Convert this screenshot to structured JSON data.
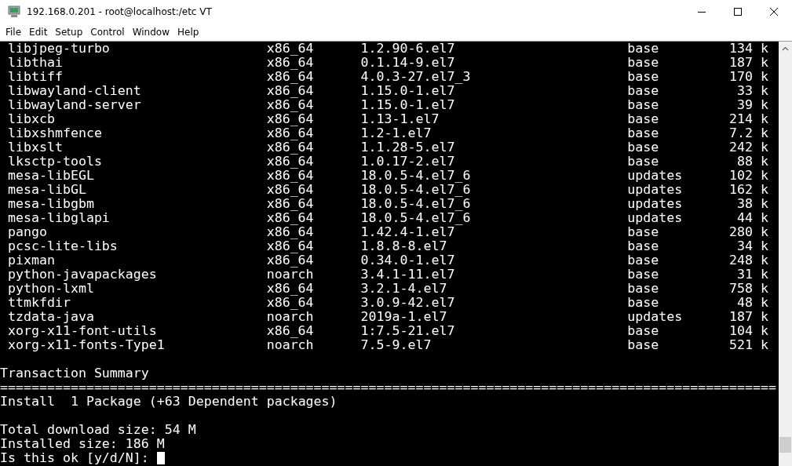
{
  "window": {
    "title": "192.168.0.201 - root@localhost:/etc VT"
  },
  "menu": [
    "File",
    "Edit",
    "Setup",
    "Control",
    "Window",
    "Help"
  ],
  "terminal": {
    "packages": [
      {
        "name": "libjpeg-turbo",
        "arch": "x86_64",
        "version": "1.2.90-6.el7",
        "repository": "base",
        "size": "134 k"
      },
      {
        "name": "libthai",
        "arch": "x86_64",
        "version": "0.1.14-9.el7",
        "repository": "base",
        "size": "187 k"
      },
      {
        "name": "libtiff",
        "arch": "x86_64",
        "version": "4.0.3-27.el7_3",
        "repository": "base",
        "size": "170 k"
      },
      {
        "name": "libwayland-client",
        "arch": "x86_64",
        "version": "1.15.0-1.el7",
        "repository": "base",
        "size": "33 k"
      },
      {
        "name": "libwayland-server",
        "arch": "x86_64",
        "version": "1.15.0-1.el7",
        "repository": "base",
        "size": "39 k"
      },
      {
        "name": "libxcb",
        "arch": "x86_64",
        "version": "1.13-1.el7",
        "repository": "base",
        "size": "214 k"
      },
      {
        "name": "libxshmfence",
        "arch": "x86_64",
        "version": "1.2-1.el7",
        "repository": "base",
        "size": "7.2 k"
      },
      {
        "name": "libxslt",
        "arch": "x86_64",
        "version": "1.1.28-5.el7",
        "repository": "base",
        "size": "242 k"
      },
      {
        "name": "lksctp-tools",
        "arch": "x86_64",
        "version": "1.0.17-2.el7",
        "repository": "base",
        "size": "88 k"
      },
      {
        "name": "mesa-libEGL",
        "arch": "x86_64",
        "version": "18.0.5-4.el7_6",
        "repository": "updates",
        "size": "102 k"
      },
      {
        "name": "mesa-libGL",
        "arch": "x86_64",
        "version": "18.0.5-4.el7_6",
        "repository": "updates",
        "size": "162 k"
      },
      {
        "name": "mesa-libgbm",
        "arch": "x86_64",
        "version": "18.0.5-4.el7_6",
        "repository": "updates",
        "size": "38 k"
      },
      {
        "name": "mesa-libglapi",
        "arch": "x86_64",
        "version": "18.0.5-4.el7_6",
        "repository": "updates",
        "size": "44 k"
      },
      {
        "name": "pango",
        "arch": "x86_64",
        "version": "1.42.4-1.el7",
        "repository": "base",
        "size": "280 k"
      },
      {
        "name": "pcsc-lite-libs",
        "arch": "x86_64",
        "version": "1.8.8-8.el7",
        "repository": "base",
        "size": "34 k"
      },
      {
        "name": "pixman",
        "arch": "x86_64",
        "version": "0.34.0-1.el7",
        "repository": "base",
        "size": "248 k"
      },
      {
        "name": "python-javapackages",
        "arch": "noarch",
        "version": "3.4.1-11.el7",
        "repository": "base",
        "size": "31 k"
      },
      {
        "name": "python-lxml",
        "arch": "x86_64",
        "version": "3.2.1-4.el7",
        "repository": "base",
        "size": "758 k"
      },
      {
        "name": "ttmkfdir",
        "arch": "x86_64",
        "version": "3.0.9-42.el7",
        "repository": "base",
        "size": "48 k"
      },
      {
        "name": "tzdata-java",
        "arch": "noarch",
        "version": "2019a-1.el7",
        "repository": "updates",
        "size": "187 k"
      },
      {
        "name": "xorg-x11-font-utils",
        "arch": "x86_64",
        "version": "1:7.5-21.el7",
        "repository": "base",
        "size": "104 k"
      },
      {
        "name": "xorg-x11-fonts-Type1",
        "arch": "noarch",
        "version": "7.5-9.el7",
        "repository": "base",
        "size": "521 k"
      }
    ],
    "summary_title": "Transaction Summary",
    "separator": "===================================================================================================",
    "install_line": "Install  1 Package (+63 Dependent packages)",
    "download_size": "Total download size: 54 M",
    "installed_size": "Installed size: 186 M",
    "prompt": "Is this ok [y/d/N]:"
  }
}
